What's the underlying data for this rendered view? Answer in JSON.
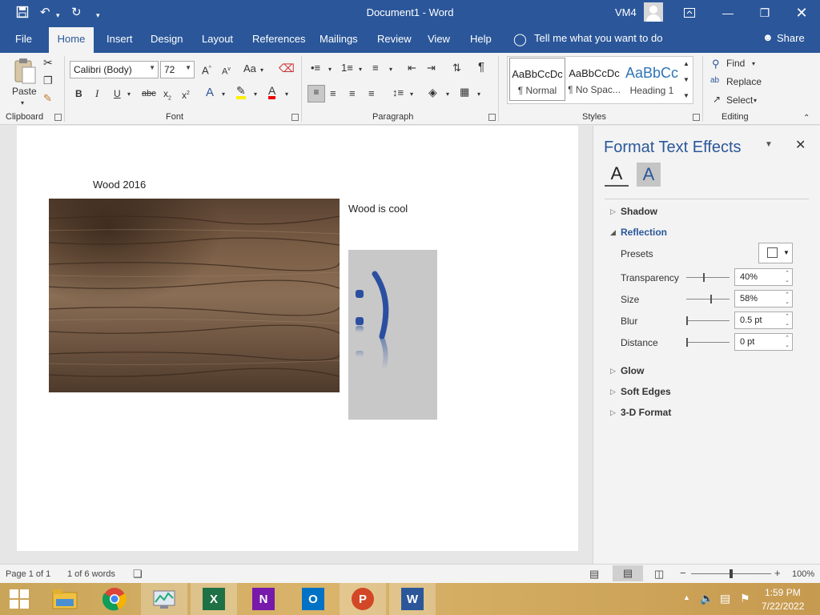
{
  "app": {
    "doc_title": "Document1  -  Word",
    "user": "VM4"
  },
  "tabs": [
    "File",
    "Home",
    "Insert",
    "Design",
    "Layout",
    "References",
    "Mailings",
    "Review",
    "View",
    "Help"
  ],
  "tell_me": "Tell me what you want to do",
  "share": "Share",
  "ribbon": {
    "clipboard": {
      "label": "Clipboard",
      "paste": "Paste"
    },
    "font": {
      "label": "Font",
      "font_name": "Calibri (Body)",
      "font_size": "72"
    },
    "paragraph": {
      "label": "Paragraph"
    },
    "styles": {
      "label": "Styles",
      "items": [
        {
          "sample": "AaBbCcDc",
          "name": "¶ Normal"
        },
        {
          "sample": "AaBbCcDc",
          "name": "¶ No Spac..."
        },
        {
          "sample": "AaBbCc",
          "name": "Heading 1"
        }
      ]
    },
    "editing": {
      "label": "Editing",
      "find": "Find",
      "replace": "Replace",
      "select": "Select"
    }
  },
  "document": {
    "title_text": "Wood 2016",
    "side_text": "Wood is cool",
    "smiley": ":)"
  },
  "pane": {
    "title": "Format Text Effects",
    "sections": {
      "shadow": "Shadow",
      "reflection": "Reflection",
      "glow": "Glow",
      "soft_edges": "Soft Edges",
      "three_d": "3-D Format"
    },
    "props": {
      "presets": "Presets",
      "transparency": {
        "label": "Transparency",
        "value": "40%"
      },
      "size": {
        "label": "Size",
        "value": "58%"
      },
      "blur": {
        "label": "Blur",
        "value": "0.5 pt"
      },
      "distance": {
        "label": "Distance",
        "value": "0 pt"
      }
    }
  },
  "status": {
    "page": "Page 1 of 1",
    "words": "1 of 6 words",
    "zoom": "100%"
  },
  "taskbar": {
    "time": "1:59 PM",
    "date": "7/22/2022"
  },
  "colors": {
    "word_blue": "#2b579a",
    "excel_green": "#1e7145",
    "onenote_purple": "#7719aa",
    "outlook_blue": "#0072c6",
    "powerpoint_orange": "#d24726"
  }
}
